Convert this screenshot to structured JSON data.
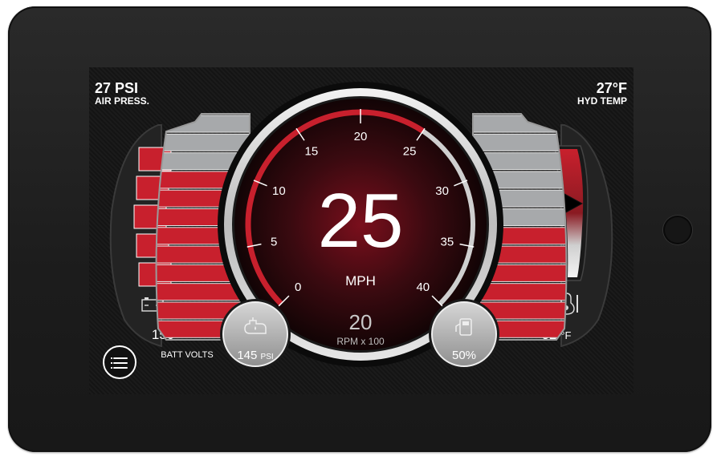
{
  "air_pressure": {
    "value": "27 PSI",
    "label": "AIR PRESS."
  },
  "hyd_temp": {
    "value": "27°F",
    "label": "HYD TEMP"
  },
  "speed": {
    "value": "25",
    "unit": "MPH",
    "ticks": [
      "0",
      "5",
      "10",
      "15",
      "20",
      "25",
      "30",
      "35",
      "40"
    ],
    "min": 0,
    "max": 40,
    "current": 25
  },
  "rpm": {
    "value": "20",
    "unit": "RPM x 100"
  },
  "battery": {
    "value": "150",
    "label": "BATT VOLTS",
    "icon": "battery-icon",
    "filled_segments": 5,
    "total_segments": 5
  },
  "oil_pressure": {
    "value": "145",
    "unit": "PSI",
    "icon": "oil-can-icon"
  },
  "fuel": {
    "value": "50%",
    "icon": "fuel-pump-icon"
  },
  "coolant_temp": {
    "value": "32",
    "unit": "°F",
    "icon": "thermometer-icon",
    "level_fraction": 0.5
  },
  "left_bar_gauge": {
    "filled_segments": 9,
    "total_segments": 12
  },
  "right_bar_gauge": {
    "filled_segments": 6,
    "total_segments": 12
  },
  "menu": {
    "icon": "menu-icon"
  },
  "colors": {
    "accent_red": "#c8202d",
    "inactive_gray": "#a7a9ab",
    "text": "#ffffff"
  }
}
